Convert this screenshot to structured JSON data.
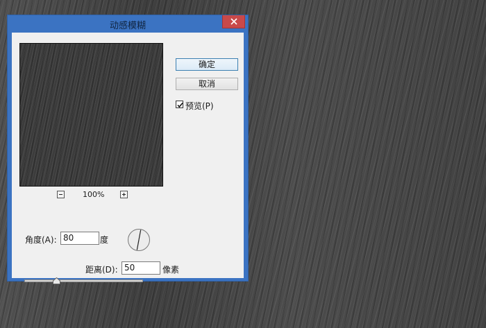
{
  "dialog": {
    "title": "动感模糊",
    "close_icon": "close-icon"
  },
  "buttons": {
    "ok_label": "确定",
    "cancel_label": "取消"
  },
  "preview_checkbox": {
    "label": "预览(P)",
    "checked": true
  },
  "zoom": {
    "level": "100%",
    "zoom_out_icon": "minus-icon",
    "zoom_in_icon": "plus-icon"
  },
  "angle": {
    "label": "角度(A):",
    "value": "80",
    "unit": "度"
  },
  "distance": {
    "label": "距离(D):",
    "value": "50",
    "unit": "像素",
    "slider_fraction": 0.05
  },
  "colors": {
    "title_bar": "#3b73c2",
    "close_button": "#c9494a",
    "dialog_body": "#f0f0f0",
    "canvas_background": "#4a4a4a"
  }
}
